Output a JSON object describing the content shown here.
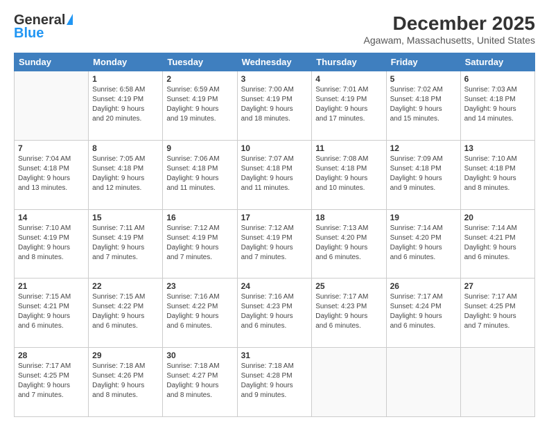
{
  "logo": {
    "line1": "General",
    "line2": "Blue"
  },
  "header": {
    "title": "December 2025",
    "subtitle": "Agawam, Massachusetts, United States"
  },
  "weekdays": [
    "Sunday",
    "Monday",
    "Tuesday",
    "Wednesday",
    "Thursday",
    "Friday",
    "Saturday"
  ],
  "weeks": [
    [
      {
        "day": "",
        "info": ""
      },
      {
        "day": "1",
        "info": "Sunrise: 6:58 AM\nSunset: 4:19 PM\nDaylight: 9 hours\nand 20 minutes."
      },
      {
        "day": "2",
        "info": "Sunrise: 6:59 AM\nSunset: 4:19 PM\nDaylight: 9 hours\nand 19 minutes."
      },
      {
        "day": "3",
        "info": "Sunrise: 7:00 AM\nSunset: 4:19 PM\nDaylight: 9 hours\nand 18 minutes."
      },
      {
        "day": "4",
        "info": "Sunrise: 7:01 AM\nSunset: 4:19 PM\nDaylight: 9 hours\nand 17 minutes."
      },
      {
        "day": "5",
        "info": "Sunrise: 7:02 AM\nSunset: 4:18 PM\nDaylight: 9 hours\nand 15 minutes."
      },
      {
        "day": "6",
        "info": "Sunrise: 7:03 AM\nSunset: 4:18 PM\nDaylight: 9 hours\nand 14 minutes."
      }
    ],
    [
      {
        "day": "7",
        "info": "Sunrise: 7:04 AM\nSunset: 4:18 PM\nDaylight: 9 hours\nand 13 minutes."
      },
      {
        "day": "8",
        "info": "Sunrise: 7:05 AM\nSunset: 4:18 PM\nDaylight: 9 hours\nand 12 minutes."
      },
      {
        "day": "9",
        "info": "Sunrise: 7:06 AM\nSunset: 4:18 PM\nDaylight: 9 hours\nand 11 minutes."
      },
      {
        "day": "10",
        "info": "Sunrise: 7:07 AM\nSunset: 4:18 PM\nDaylight: 9 hours\nand 11 minutes."
      },
      {
        "day": "11",
        "info": "Sunrise: 7:08 AM\nSunset: 4:18 PM\nDaylight: 9 hours\nand 10 minutes."
      },
      {
        "day": "12",
        "info": "Sunrise: 7:09 AM\nSunset: 4:18 PM\nDaylight: 9 hours\nand 9 minutes."
      },
      {
        "day": "13",
        "info": "Sunrise: 7:10 AM\nSunset: 4:18 PM\nDaylight: 9 hours\nand 8 minutes."
      }
    ],
    [
      {
        "day": "14",
        "info": "Sunrise: 7:10 AM\nSunset: 4:19 PM\nDaylight: 9 hours\nand 8 minutes."
      },
      {
        "day": "15",
        "info": "Sunrise: 7:11 AM\nSunset: 4:19 PM\nDaylight: 9 hours\nand 7 minutes."
      },
      {
        "day": "16",
        "info": "Sunrise: 7:12 AM\nSunset: 4:19 PM\nDaylight: 9 hours\nand 7 minutes."
      },
      {
        "day": "17",
        "info": "Sunrise: 7:12 AM\nSunset: 4:19 PM\nDaylight: 9 hours\nand 7 minutes."
      },
      {
        "day": "18",
        "info": "Sunrise: 7:13 AM\nSunset: 4:20 PM\nDaylight: 9 hours\nand 6 minutes."
      },
      {
        "day": "19",
        "info": "Sunrise: 7:14 AM\nSunset: 4:20 PM\nDaylight: 9 hours\nand 6 minutes."
      },
      {
        "day": "20",
        "info": "Sunrise: 7:14 AM\nSunset: 4:21 PM\nDaylight: 9 hours\nand 6 minutes."
      }
    ],
    [
      {
        "day": "21",
        "info": "Sunrise: 7:15 AM\nSunset: 4:21 PM\nDaylight: 9 hours\nand 6 minutes."
      },
      {
        "day": "22",
        "info": "Sunrise: 7:15 AM\nSunset: 4:22 PM\nDaylight: 9 hours\nand 6 minutes."
      },
      {
        "day": "23",
        "info": "Sunrise: 7:16 AM\nSunset: 4:22 PM\nDaylight: 9 hours\nand 6 minutes."
      },
      {
        "day": "24",
        "info": "Sunrise: 7:16 AM\nSunset: 4:23 PM\nDaylight: 9 hours\nand 6 minutes."
      },
      {
        "day": "25",
        "info": "Sunrise: 7:17 AM\nSunset: 4:23 PM\nDaylight: 9 hours\nand 6 minutes."
      },
      {
        "day": "26",
        "info": "Sunrise: 7:17 AM\nSunset: 4:24 PM\nDaylight: 9 hours\nand 6 minutes."
      },
      {
        "day": "27",
        "info": "Sunrise: 7:17 AM\nSunset: 4:25 PM\nDaylight: 9 hours\nand 7 minutes."
      }
    ],
    [
      {
        "day": "28",
        "info": "Sunrise: 7:17 AM\nSunset: 4:25 PM\nDaylight: 9 hours\nand 7 minutes."
      },
      {
        "day": "29",
        "info": "Sunrise: 7:18 AM\nSunset: 4:26 PM\nDaylight: 9 hours\nand 8 minutes."
      },
      {
        "day": "30",
        "info": "Sunrise: 7:18 AM\nSunset: 4:27 PM\nDaylight: 9 hours\nand 8 minutes."
      },
      {
        "day": "31",
        "info": "Sunrise: 7:18 AM\nSunset: 4:28 PM\nDaylight: 9 hours\nand 9 minutes."
      },
      {
        "day": "",
        "info": ""
      },
      {
        "day": "",
        "info": ""
      },
      {
        "day": "",
        "info": ""
      }
    ]
  ]
}
